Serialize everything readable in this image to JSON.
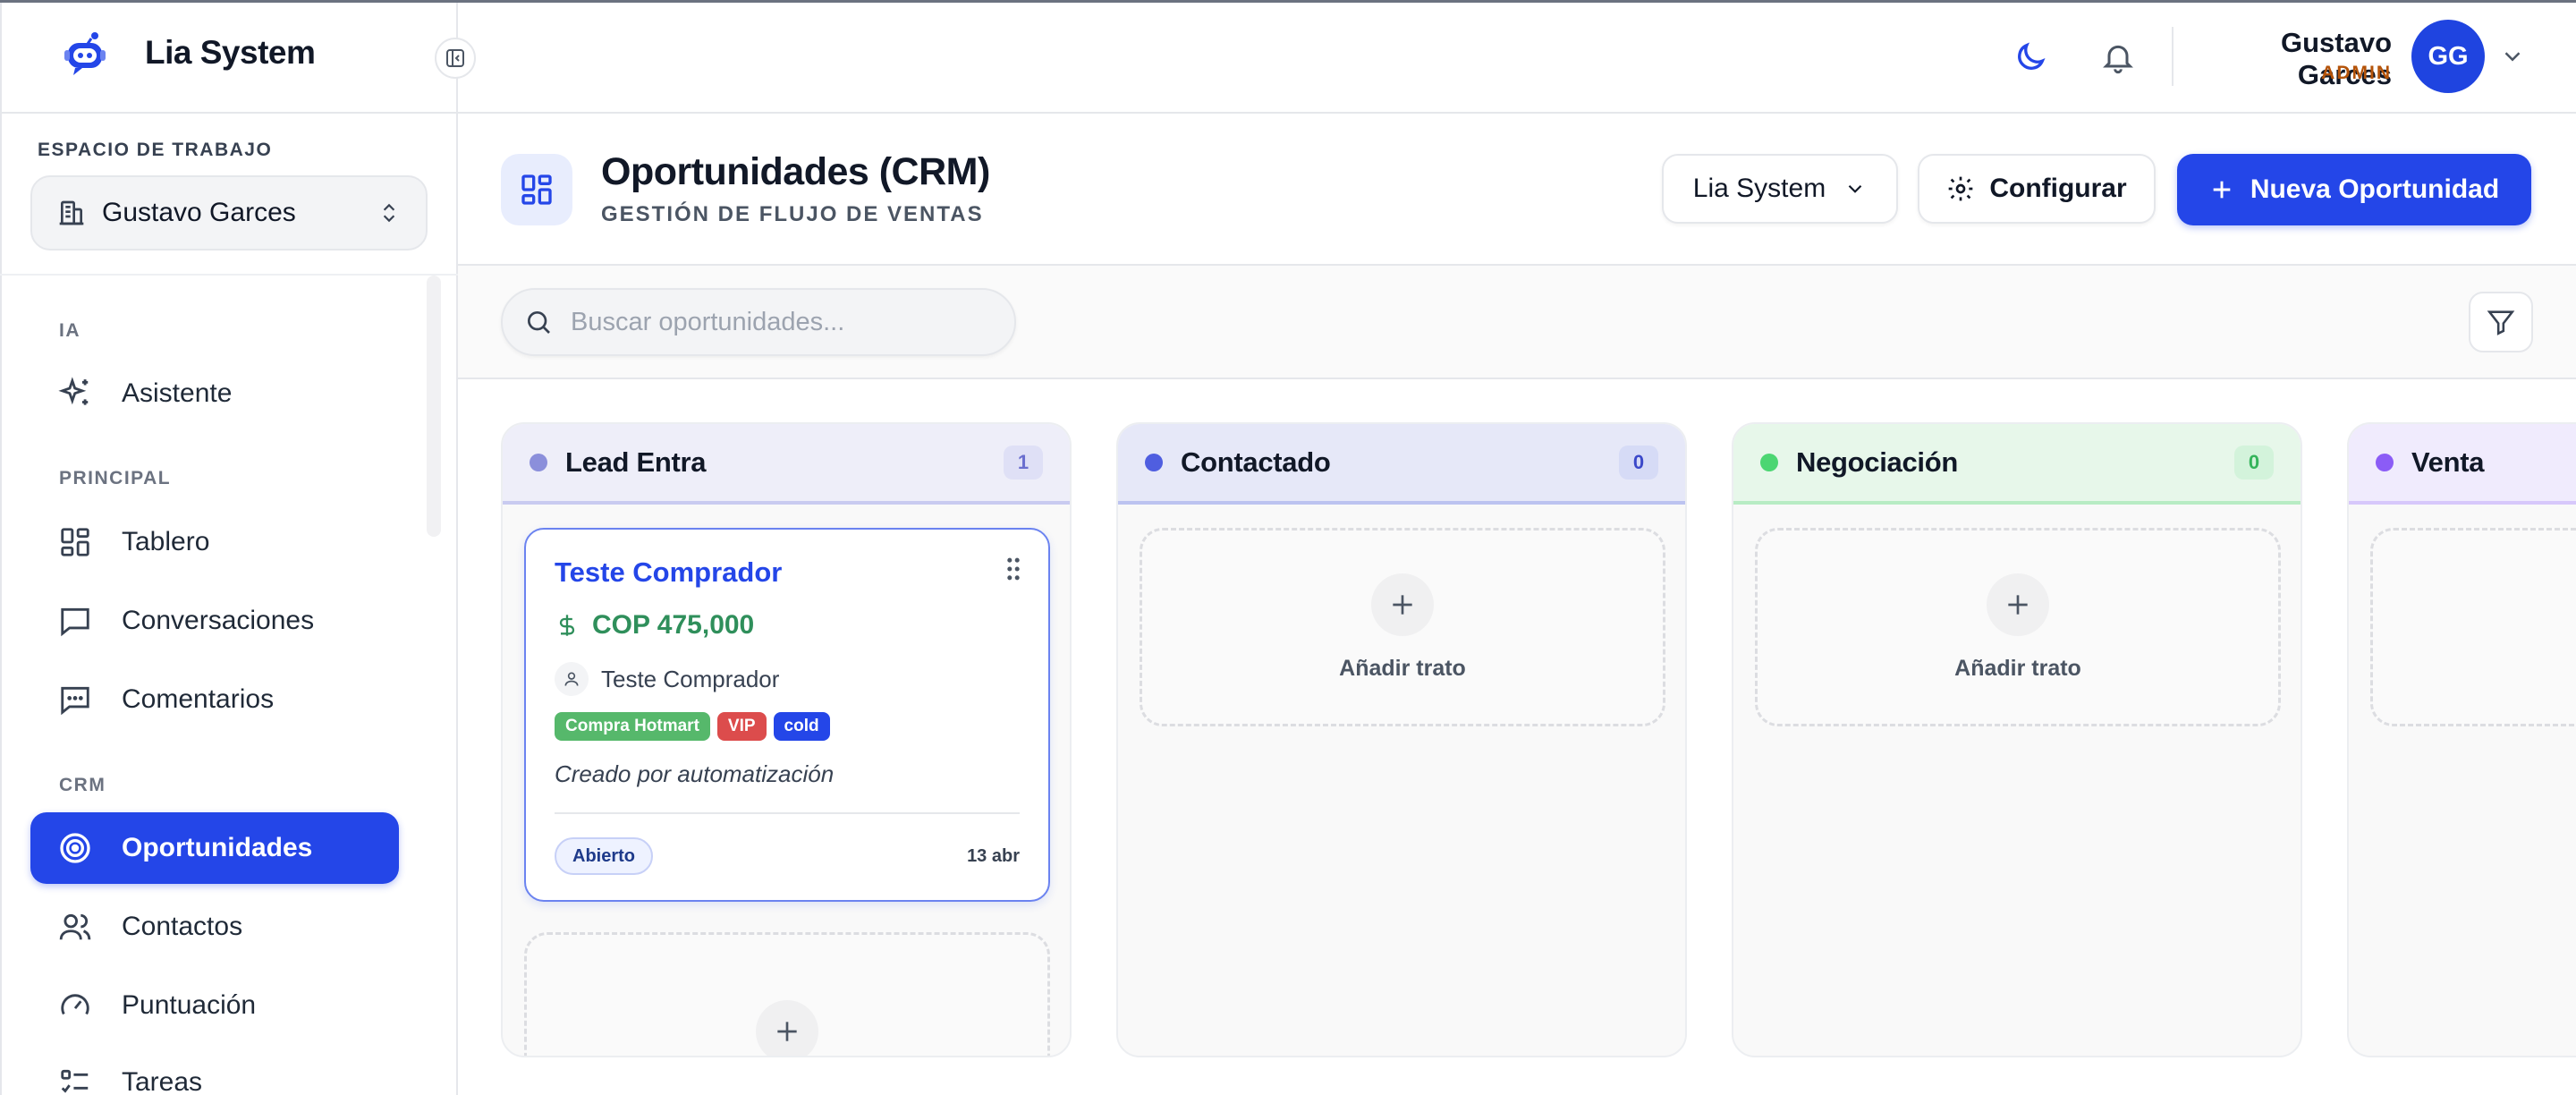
{
  "app": {
    "title": "Lia System"
  },
  "sidebar": {
    "workspace_label": "ESPACIO DE TRABAJO",
    "workspace_value": "Gustavo Garces",
    "sections": {
      "ia": "IA",
      "principal": "PRINCIPAL",
      "crm": "CRM"
    },
    "items": [
      {
        "label": "Asistente",
        "icon": "sparkles-icon"
      },
      {
        "label": "Tablero",
        "icon": "dashboard-icon"
      },
      {
        "label": "Conversaciones",
        "icon": "chat-icon"
      },
      {
        "label": "Comentarios",
        "icon": "comment-dots-icon"
      },
      {
        "label": "Oportunidades",
        "icon": "target-icon",
        "active": true
      },
      {
        "label": "Contactos",
        "icon": "users-icon"
      },
      {
        "label": "Puntuación",
        "icon": "gauge-icon"
      },
      {
        "label": "Tareas",
        "icon": "tasks-icon"
      }
    ]
  },
  "header": {
    "user_name": "Gustavo Garces",
    "user_role": "ADMIN",
    "avatar_initials": "GG"
  },
  "page": {
    "title": "Oportunidades (CRM)",
    "subtitle": "GESTIÓN DE FLUJO DE VENTAS",
    "pipeline_select": "Lia System",
    "configure_label": "Configurar",
    "new_label": "Nueva Oportunidad",
    "search_placeholder": "Buscar oportunidades..."
  },
  "colors": {
    "primary": "#2446e8",
    "money": "#2f8f5b",
    "role": "#b45309"
  },
  "board": {
    "add_label": "Añadir trato",
    "columns": [
      {
        "title": "Lead Entra",
        "count": "1",
        "dot": "#8b8fdb",
        "head_bg": "#eeeef9",
        "head_border": "#c9cbf0",
        "count_bg": "#dfe0f6",
        "count_color": "#6b6fcf"
      },
      {
        "title": "Contactado",
        "count": "0",
        "dot": "#4f5ee0",
        "head_bg": "#e6e8f8",
        "head_border": "#bcc3f0",
        "count_bg": "#d6dbf6",
        "count_color": "#3b48c9"
      },
      {
        "title": "Negociación",
        "count": "0",
        "dot": "#4cd672",
        "head_bg": "#e7f7ea",
        "head_border": "#b8ecc4",
        "count_bg": "#d3f3db",
        "count_color": "#34b45a"
      },
      {
        "title": "Venta",
        "count": "",
        "dot": "#8b5cf6",
        "head_bg": "#f0ebfd",
        "head_border": "#d7c8fb",
        "count_bg": "#e5dcfc",
        "count_color": "#7c3aed"
      }
    ],
    "deal": {
      "title": "Teste Comprador",
      "amount": "COP 475,000",
      "contact": "Teste Comprador",
      "tags": [
        {
          "label": "Compra Hotmart",
          "color": "#56b86b"
        },
        {
          "label": "VIP",
          "color": "#dc4c4c"
        },
        {
          "label": "cold",
          "color": "#2446e8"
        }
      ],
      "note": "Creado por automatización",
      "status": "Abierto",
      "date": "13 abr"
    }
  }
}
